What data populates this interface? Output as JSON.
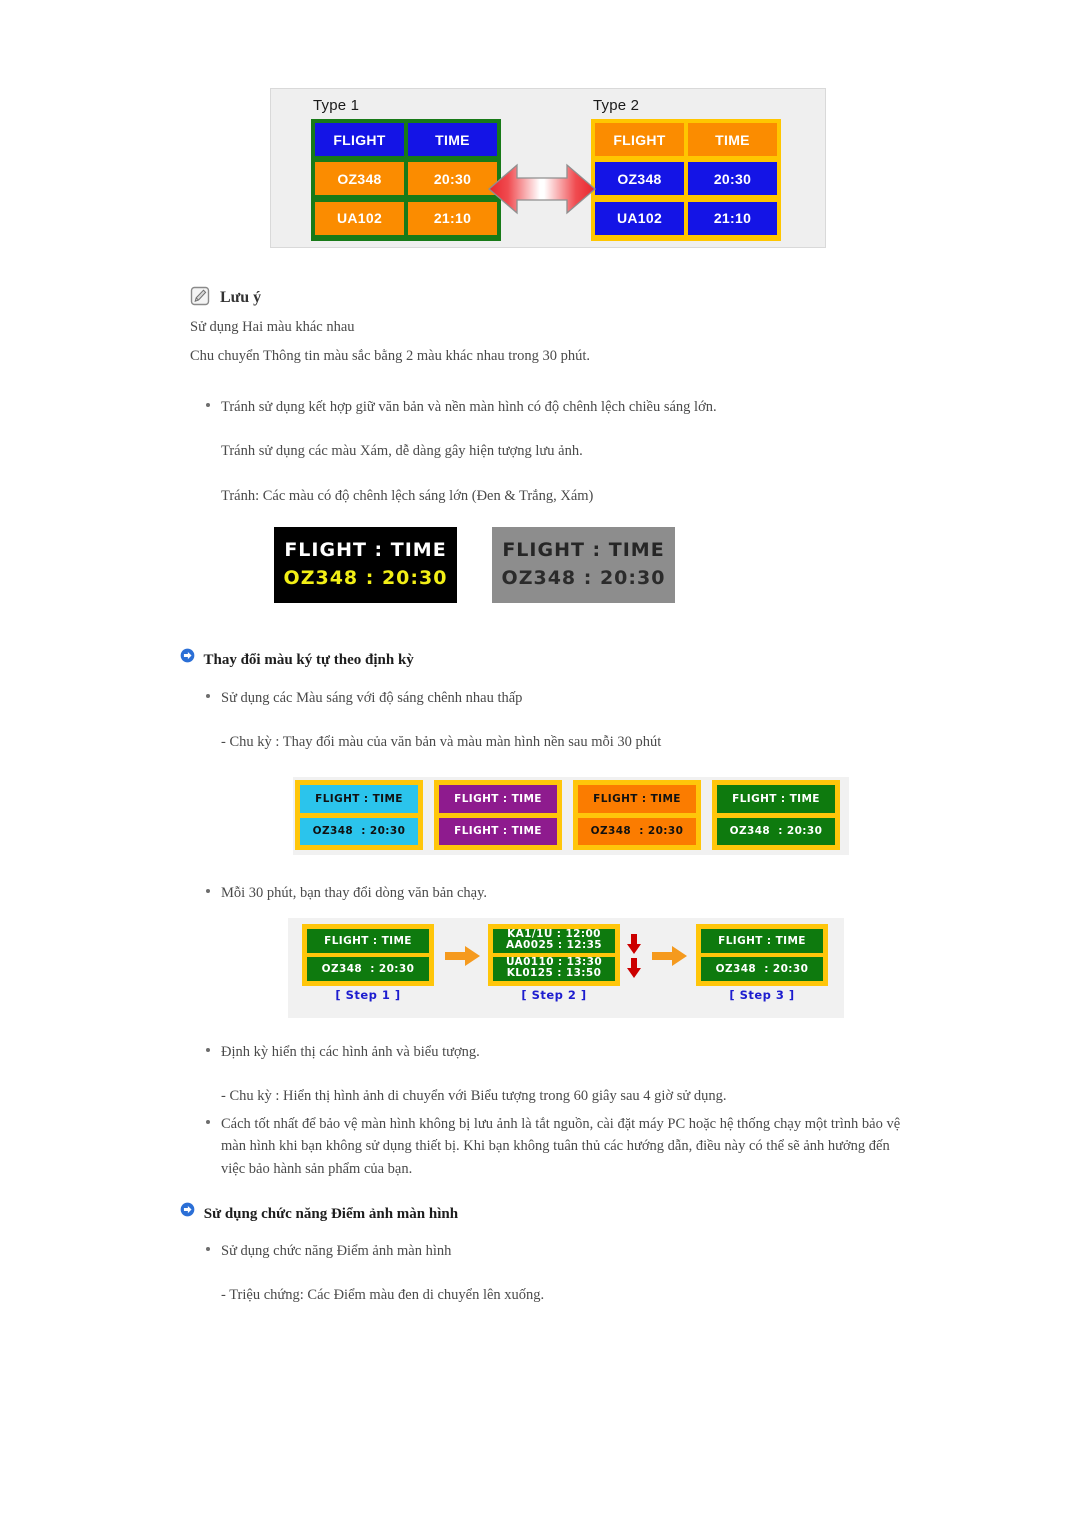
{
  "figure_types": {
    "name": "type-comparison-figure",
    "type1": {
      "label": "Type 1",
      "cells": [
        {
          "text": "FLIGHT",
          "color": "blue"
        },
        {
          "text": "TIME",
          "color": "blue"
        },
        {
          "text": "OZ348",
          "color": "orange"
        },
        {
          "text": "20:30",
          "color": "orange"
        },
        {
          "text": "UA102",
          "color": "orange"
        },
        {
          "text": "21:10",
          "color": "orange"
        }
      ],
      "border_color": "#187a18"
    },
    "type2": {
      "label": "Type 2",
      "cells": [
        {
          "text": "FLIGHT",
          "color": "orange"
        },
        {
          "text": "TIME",
          "color": "orange"
        },
        {
          "text": "OZ348",
          "color": "blue"
        },
        {
          "text": "20:30",
          "color": "blue"
        },
        {
          "text": "UA102",
          "color": "blue"
        },
        {
          "text": "21:10",
          "color": "blue"
        }
      ],
      "border_color": "#ffc600"
    },
    "arrow": "double-arrow-red"
  },
  "note": {
    "icon": "note-pencil-icon",
    "title": "Lưu ý",
    "lines": [
      "Sử dụng Hai màu khác nhau",
      "Chu chuyển Thông tin màu sắc bằng 2 màu khác nhau trong 30 phút."
    ]
  },
  "avoid_section": {
    "bullet": "Tránh sử dụng kết hợp giữ văn bản và nền màn hình có độ chênh lệch chiều sáng lớn.",
    "sub1": "Tránh sử dụng các màu Xám, dễ dàng gây hiện tượng lưu ảnh.",
    "sub2": "Tránh: Các màu có độ chênh lệch sáng lớn (Đen & Trắng, Xám)"
  },
  "contrast_panels": [
    {
      "name": "black-panel",
      "bg": "#000000",
      "line1": "FLIGHT : TIME",
      "line2": "OZ348  : 20:30",
      "line1_color": "#ffffff",
      "line2_color": "#f2ef16"
    },
    {
      "name": "gray-panel",
      "bg": "#8d8d8d",
      "line1": "FLIGHT : TIME",
      "line2": "OZ348  : 20:30",
      "line1_color": "#262626",
      "line2_color": "#2b2b2b"
    }
  ],
  "section_periodic": {
    "icon": "blue-arrow-bullet-icon",
    "title": "Thay đổi màu ký tự theo định kỳ",
    "bullet1": "Sử dụng các Màu sáng với độ sáng chênh nhau thấp",
    "sub1": "- Chu kỳ : Thay đổi màu của văn bản và màu màn hình nền sau mỗi 30 phút",
    "bullet2": "Mỗi 30 phút, bạn thay đổi dòng văn bản chạy.",
    "bullet3": "Định kỳ hiển thị các hình ảnh và biểu tượng.",
    "sub3": "- Chu kỳ : Hiển thị hình ảnh di chuyển với Biểu tượng trong 60 giây sau 4 giờ sử dụng.",
    "bullet4": "Cách tốt nhất để bảo vệ màn hình không bị lưu ảnh là tắt nguồn, cài đặt máy PC hoặc hệ thống chạy một trình bảo vệ màn hình khi bạn không sử dụng thiết bị. Khi bạn không tuân thủ các hướng dẫn, điều này có thể sẽ ảnh hưởng đến việc bảo hành sản phẩm của bạn."
  },
  "color_panels": {
    "name": "color-cycle-figure",
    "border_color": "#ffc60a",
    "panels": [
      {
        "name": "cyan-panel",
        "bg": "#2bc4ec",
        "text_color": "#111111",
        "line1": "FLIGHT : TIME",
        "line2": "OZ348  : 20:30"
      },
      {
        "name": "purple-panel",
        "bg": "#8e1b8e",
        "text_color": "#ffffff",
        "line1": "FLIGHT : TIME",
        "line2": "FLIGHT : TIME"
      },
      {
        "name": "orange-panel",
        "bg": "#fb7c00",
        "text_color": "#111111",
        "line1": "FLIGHT : TIME",
        "line2": "OZ348  : 20:30"
      },
      {
        "name": "green-panel",
        "bg": "#0e7a0e",
        "text_color": "#ffffff",
        "line1": "FLIGHT : TIME",
        "line2": "OZ348  : 20:30"
      }
    ]
  },
  "steps_figure": {
    "name": "scrolling-steps-figure",
    "arrow_color": "#f59a1e",
    "down_arrow_color": "#cc0000",
    "steps": [
      {
        "caption": "[ Step 1 ]",
        "line1": "FLIGHT : TIME",
        "line2": "OZ348  : 20:30"
      },
      {
        "caption": "[ Step 2 ]",
        "line1_top": "KA1/1U : 12:00",
        "line1_bottom": "AA0025 : 12:35",
        "line2_top": "UA0110 : 13:30",
        "line2_bottom": "KL0125 : 13:50"
      },
      {
        "caption": "[ Step 3 ]",
        "line1": "FLIGHT : TIME",
        "line2": "OZ348  : 20:30"
      }
    ]
  },
  "section_pixel": {
    "icon": "blue-arrow-bullet-icon",
    "title": "Sử dụng chức năng Điểm ảnh màn hình",
    "bullet1": "Sử dụng chức năng Điểm ảnh màn hình",
    "sub1": "- Triệu chứng: Các Điểm màu đen di chuyển lên xuống."
  }
}
